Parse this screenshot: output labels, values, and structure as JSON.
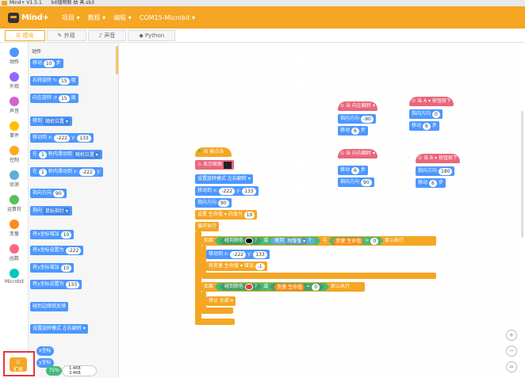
{
  "titlebar": {
    "app": "Mind+ V1.5.1",
    "file": "bit植物联 姑 蒸.sb3"
  },
  "menubar": {
    "logo": "Mind+",
    "items": [
      "项目 ▾",
      "教程 ▾",
      "编程 ▾",
      "COM15-Microbit ▾"
    ]
  },
  "tabs": [
    "模块",
    "外观",
    "声音",
    "Python"
  ],
  "categories": [
    {
      "label": "动作",
      "color": "#4c97ff"
    },
    {
      "label": "外观",
      "color": "#9966ff"
    },
    {
      "label": "声音",
      "color": "#cf63cf"
    },
    {
      "label": "事件",
      "color": "#ffbf00"
    },
    {
      "label": "控制",
      "color": "#ffab19"
    },
    {
      "label": "侦测",
      "color": "#5cb1d6"
    },
    {
      "label": "运算符",
      "color": "#59c059"
    },
    {
      "label": "变量",
      "color": "#ff8c1a"
    },
    {
      "label": "函数",
      "color": "#ff6680"
    },
    {
      "label": "Microbit",
      "color": "#00c7bd"
    }
  ],
  "palette": {
    "title": "动作",
    "blocks": {
      "move": "移动",
      "move_n": "10",
      "move_unit": "步",
      "turn_r": "右转旋转 ↻",
      "turn_r_n": "15",
      "turn_r_unit": "度",
      "turn_l": "向左旋转 ↺",
      "turn_l_n": "15",
      "turn_l_unit": "度",
      "goto": "移到",
      "goto_dd": "随机位置 ▾",
      "gotoxy": "移动到 x:",
      "gotoxy_x": "-222",
      "gotoxy_y_label": "y:",
      "gotoxy_y": "133",
      "glide1": "在",
      "glide1_n": "1",
      "glide1_mid": "秒内滑动到",
      "glide1_dd": "随机位置 ▾",
      "glide2": "在",
      "glide2_n": "1",
      "glide2_mid": "秒内滑动到 x:",
      "glide2_x": "-222",
      "glide2_y": "y:",
      "point": "指向方向",
      "point_n": "90",
      "pointto": "指向",
      "pointto_dd": "鼠标指针 ▾",
      "chx": "将x坐标增加",
      "chx_n": "10",
      "setx": "将x坐标设置为",
      "setx_n": "-222",
      "chy": "将y坐标增加",
      "chy_n": "10",
      "sety": "将y坐标设置为",
      "sety_n": "133",
      "bounce": "碰到边缘就反弹",
      "rotstyle": "设置旋转模式 左右翻转 ▾",
      "xpos": "x坐标",
      "ypos": "y坐标"
    },
    "ext_label": "扩展",
    "badge": "75%",
    "gauge_top": "1.4KB",
    "gauge_bot": "3.4KB"
  },
  "workspace": {
    "main_script": {
      "hat": "当 被点击",
      "show": "显示图案",
      "rotmode": "设置旋转模式 左右翻转 ▾",
      "gotoxy": "移动到 x:",
      "x": "-222",
      "y_label": "y:",
      "y": "133",
      "point": "指向方向",
      "point_n": "90",
      "setvar": "设置 生命值 ▾ 的值为",
      "setvar_n": "10",
      "forever": "循环执行",
      "if1": "如果",
      "touch_color": "碰到颜色",
      "q": "?",
      "or": "或",
      "touch": "碰到",
      "touch_dd": "网蟹蟹 ▾",
      "q2": "?",
      "and": "与",
      "var_label": "变量 生命值",
      "gt": ">",
      "zero": "0",
      "then": "那么执行",
      "in_goto": "移动到 x:",
      "in_x": "-222",
      "in_y_label": "y:",
      "in_y": "133",
      "change": "将变量 生命值 ▾ 增加",
      "change_n": "-1",
      "if2": "如果",
      "touch_color2": "碰到颜色",
      "q3": "?",
      "or2": "或",
      "var_label2": "变量 生命值",
      "eq": "=",
      "zero2": "0",
      "then2": "那么执行",
      "stop": "停止 全部 ▾"
    },
    "s_left_arrow": {
      "hat": "当 向左翻转 ▾",
      "dir": "指向方向",
      "dir_n": "-90",
      "move": "移动",
      "move_n": "6",
      "unit": "步"
    },
    "s_button_a": {
      "hat": "当 A ▾ 按钮按下",
      "dir": "指向方向",
      "dir_n": "0",
      "move": "移动",
      "move_n": "6",
      "unit": "步"
    },
    "s_right_arrow": {
      "hat": "当 向右翻转 ▾",
      "move": "移动",
      "move_n": "6",
      "unit": "步",
      "dir": "指向方向",
      "dir_n": "90"
    },
    "s_button_b": {
      "hat": "当 B ▾ 按钮按下",
      "dir": "指向方向",
      "dir_n": "180",
      "move": "移动",
      "move_n": "6",
      "unit": "步"
    }
  },
  "zoom": {
    "in": "+",
    "out": "−",
    "reset": "="
  }
}
